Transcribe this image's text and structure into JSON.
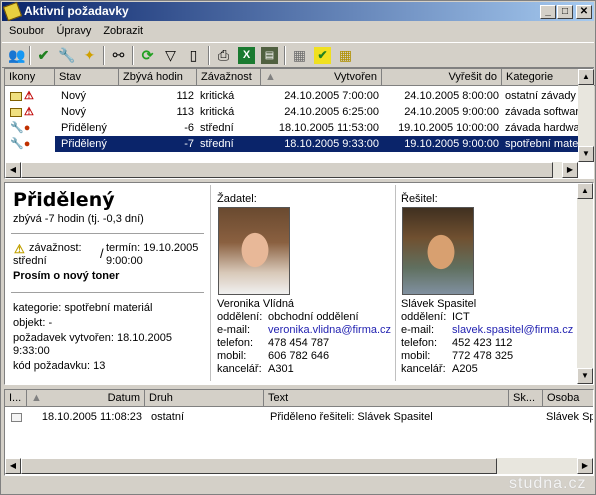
{
  "window": {
    "title": "Aktivní požadavky"
  },
  "menu": [
    "Soubor",
    "Úpravy",
    "Zobrazit"
  ],
  "toolbar_icons": [
    "users-icon",
    "check-icon",
    "wrench-icon",
    "new-item-icon",
    "binoculars-icon",
    "refresh-icon",
    "filter-icon",
    "panel-icon",
    "print-icon",
    "excel-icon",
    "export-icon",
    "grid-icon",
    "checkbox-icon",
    "table-icon"
  ],
  "table": {
    "columns": [
      "Ikony",
      "Stav",
      "Zbývá hodin",
      "Závažnost",
      "Vytvořen",
      "Vyřešit do",
      "Kategorie"
    ],
    "rows": [
      {
        "stav": "Nový",
        "zbyva": "112",
        "zavaznost": "kritická",
        "vytvoren": "24.10.2005 7:00:00",
        "vyresit": "24.10.2005 8:00:00",
        "kategorie": "ostatní závady"
      },
      {
        "stav": "Nový",
        "zbyva": "113",
        "zavaznost": "kritická",
        "vytvoren": "24.10.2005 6:25:00",
        "vyresit": "24.10.2005 9:00:00",
        "kategorie": "závada software"
      },
      {
        "stav": "Přidělený",
        "zbyva": "-6",
        "zavaznost": "střední",
        "vytvoren": "18.10.2005 11:53:00",
        "vyresit": "19.10.2005 10:00:00",
        "kategorie": "závada hardware"
      },
      {
        "stav": "Přidělený",
        "zbyva": "-7",
        "zavaznost": "střední",
        "vytvoren": "18.10.2005 9:33:00",
        "vyresit": "19.10.2005 9:00:00",
        "kategorie": "spotřební materiál"
      }
    ]
  },
  "detail": {
    "status": "Přidělený",
    "remaining": "zbývá -7 hodin (tj. -0,3 dní)",
    "severity_label": "závažnost:",
    "severity_value": "střední",
    "deadline_label": "termín: 19.10.2005",
    "deadline_time": "9:00:00",
    "subject": "Prosím o nový toner",
    "category": "kategorie: spotřební materiál",
    "object": "objekt: -",
    "created": "požadavek vytvořen: 18.10.2005",
    "created_time": "9:33:00",
    "code": "kód požadavku: 13",
    "requester": {
      "heading": "Žadatel:",
      "name": "Veronika Vlídná",
      "labels": [
        "oddělení:",
        "e-mail:",
        "telefon:",
        "mobil:",
        "kancelář:"
      ],
      "values": [
        "obchodní oddělení",
        "veronika.vlidna@firma.cz",
        "478 454 787",
        "606 782 646",
        "A301"
      ]
    },
    "solver": {
      "heading": "Řešitel:",
      "name": "Slávek Spasitel",
      "labels": [
        "oddělení:",
        "e-mail:",
        "telefon:",
        "mobil:",
        "kancelář:"
      ],
      "values": [
        "ICT",
        "slavek.spasitel@firma.cz",
        "452 423 112",
        "772 478 325",
        "A205"
      ]
    }
  },
  "history": {
    "columns": [
      "I...",
      "Datum",
      "Druh",
      "Text",
      "Sk...",
      "Osoba"
    ],
    "rows": [
      {
        "datum": "18.10.2005 11:08:23",
        "druh": "ostatní",
        "text": "Přiděleno řešiteli: Slávek Spasitel",
        "osoba": "Slávek Sp"
      }
    ]
  },
  "watermark": "studna.cz",
  "colors": {
    "selection": "#0a246a",
    "link": "#1f1fb0",
    "titlebar": "#0a246a"
  }
}
